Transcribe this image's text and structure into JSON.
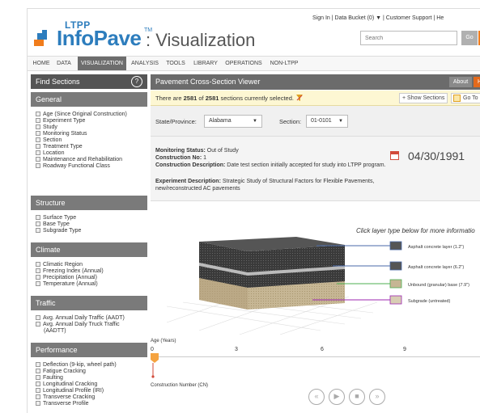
{
  "header": {
    "ltpp": "LTPP",
    "brand": "InfoPave",
    "tm": "TM",
    "viz": ": Visualization",
    "links": [
      "Sign In",
      "Data Bucket (0) ▼",
      "Customer Support",
      "He"
    ],
    "search_placeholder": "Search",
    "go_label": "Go"
  },
  "nav": [
    "HOME",
    "DATA",
    "VISUALIZATION",
    "ANALYSIS",
    "TOOLS",
    "LIBRARY",
    "OPERATIONS",
    "NON-LTPP"
  ],
  "nav_active": "VISUALIZATION",
  "sidebar": {
    "title": "Find Sections",
    "help": "?",
    "groups": [
      {
        "name": "General",
        "items": [
          "Age (Since Original Construction)",
          "Experiment Type",
          "Study",
          "Monitoring Status",
          "Section",
          "Treatment Type",
          "Location",
          "Maintenance and Rehabilitation",
          "Roadway Functional Class"
        ]
      },
      {
        "name": "Structure",
        "items": [
          "Surface Type",
          "Base Type",
          "Subgrade Type"
        ]
      },
      {
        "name": "Climate",
        "items": [
          "Climatic Region",
          "Freezing Index (Annual)",
          "Precipitation (Annual)",
          "Temperature (Annual)"
        ]
      },
      {
        "name": "Traffic",
        "items": [
          "Avg. Annual Daily Traffic (AADT)",
          "Avg. Annual Daily Truck Traffic",
          "(AADTT)"
        ]
      },
      {
        "name": "Performance",
        "items": [
          "Deflection (9-kip, wheel path)",
          "Fatigue Cracking",
          "Faulting",
          "Longitudinal Cracking",
          "Longitudinal Profile (IRI)",
          "Transverse Cracking",
          "Transverse Profile"
        ]
      }
    ]
  },
  "main": {
    "title": "Pavement Cross-Section Viewer",
    "about": "About",
    "help_tour": "Help Tou",
    "selection_msg_pre": "There are ",
    "selected": "2581",
    "of": " of ",
    "total": "2581",
    "selection_msg_post": " sections currently selected.",
    "show_sections": "+ Show Sections",
    "go_to": "Go To",
    "state_label": "State/Province:",
    "state_value": "Alabama",
    "section_label": "Section:",
    "section_value": "01-0101",
    "monitoring_label": "Monitoring Status:",
    "monitoring_value": "Out of Study",
    "construction_no_label": "Construction No:",
    "construction_no_value": "1",
    "construction_desc_label": "Construction Description:",
    "construction_desc_value": "Date test section initially accepted for study into LTPP program.",
    "experiment_label": "Experiment Description:",
    "experiment_value_1": "Strategic Study of Structural Factors for Flexible Pavements,",
    "experiment_value_2": "new/reconstructed AC pavements",
    "date": "04/30/1991",
    "click_hint": "Click layer type below for more informatio",
    "layers": [
      "Asphalt concrete layer (1.2\")",
      "Asphalt concrete layer (6.2\")",
      "Unbound (granular) base (7.9\")",
      "Subgrade (untreated)"
    ],
    "layer_colors": [
      "#4a6aa8",
      "#4a6aa8",
      "#4caf50",
      "#9c27b0"
    ],
    "age_label": "Age (Years)",
    "ticks": [
      "0",
      "3",
      "6",
      "9"
    ],
    "cn_label": "Construction Number (CN)",
    "controls": [
      "rewind-icon",
      "play-icon",
      "stop-icon",
      "fast-forward-icon"
    ]
  }
}
